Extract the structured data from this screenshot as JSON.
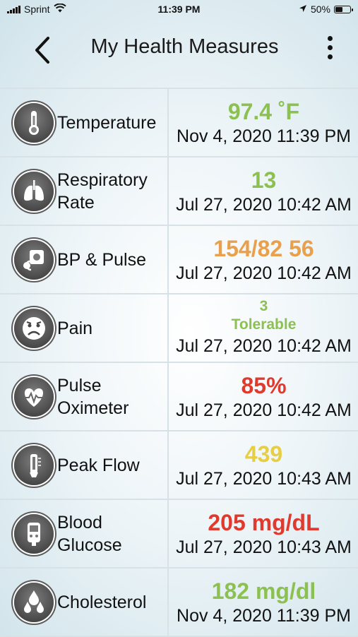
{
  "status_bar": {
    "carrier": "Sprint",
    "time": "11:39 PM",
    "battery_percent": "50%",
    "battery_level": 0.5,
    "icons": [
      "signal-icon",
      "wifi-icon",
      "location-arrow-icon",
      "battery-icon"
    ]
  },
  "header": {
    "title": "My Health Measures",
    "back_icon": "chevron-left-icon",
    "menu_icon": "more-vertical-icon"
  },
  "colors": {
    "green": "#8cc152",
    "orange": "#e8a04c",
    "red": "#e03a2e",
    "yellow": "#e6cf45",
    "icon_bg": "#4a4a4a"
  },
  "measures": [
    {
      "label": "Temperature",
      "icon": "thermometer-icon",
      "value": "97.4 ˚F",
      "value_color": "#8cc152",
      "date": "Nov 4, 2020 11:39 PM"
    },
    {
      "label": "Respiratory Rate",
      "icon": "lungs-icon",
      "value": "13",
      "value_color": "#8cc152",
      "date": "Jul 27, 2020 10:42 AM"
    },
    {
      "label": "BP & Pulse",
      "icon": "blood-pressure-cuff-icon",
      "value": "154/82 56",
      "value_color": "#e8a04c",
      "date": "Jul 27, 2020 10:42 AM"
    },
    {
      "label": "Pain",
      "icon": "sad-face-icon",
      "value": "3",
      "value_line2": "Tolerable",
      "value_color": "#8cc152",
      "date": "Jul 27, 2020 10:42 AM"
    },
    {
      "label": "Pulse Oximeter",
      "icon": "heart-pulse-icon",
      "value": "85%",
      "value_color": "#e03a2e",
      "date": "Jul 27, 2020 10:42 AM"
    },
    {
      "label": "Peak Flow",
      "icon": "peak-flow-meter-icon",
      "value": "439",
      "value_color": "#e6cf45",
      "date": "Jul 27, 2020 10:43 AM"
    },
    {
      "label": "Blood Glucose",
      "icon": "glucose-meter-icon",
      "value": "205 mg/dL",
      "value_color": "#e03a2e",
      "date": "Jul 27, 2020 10:43 AM"
    },
    {
      "label": "Cholesterol",
      "icon": "drops-icon",
      "value": "182 mg/dl",
      "value_color": "#8cc152",
      "date": "Nov 4, 2020 11:39 PM"
    }
  ]
}
